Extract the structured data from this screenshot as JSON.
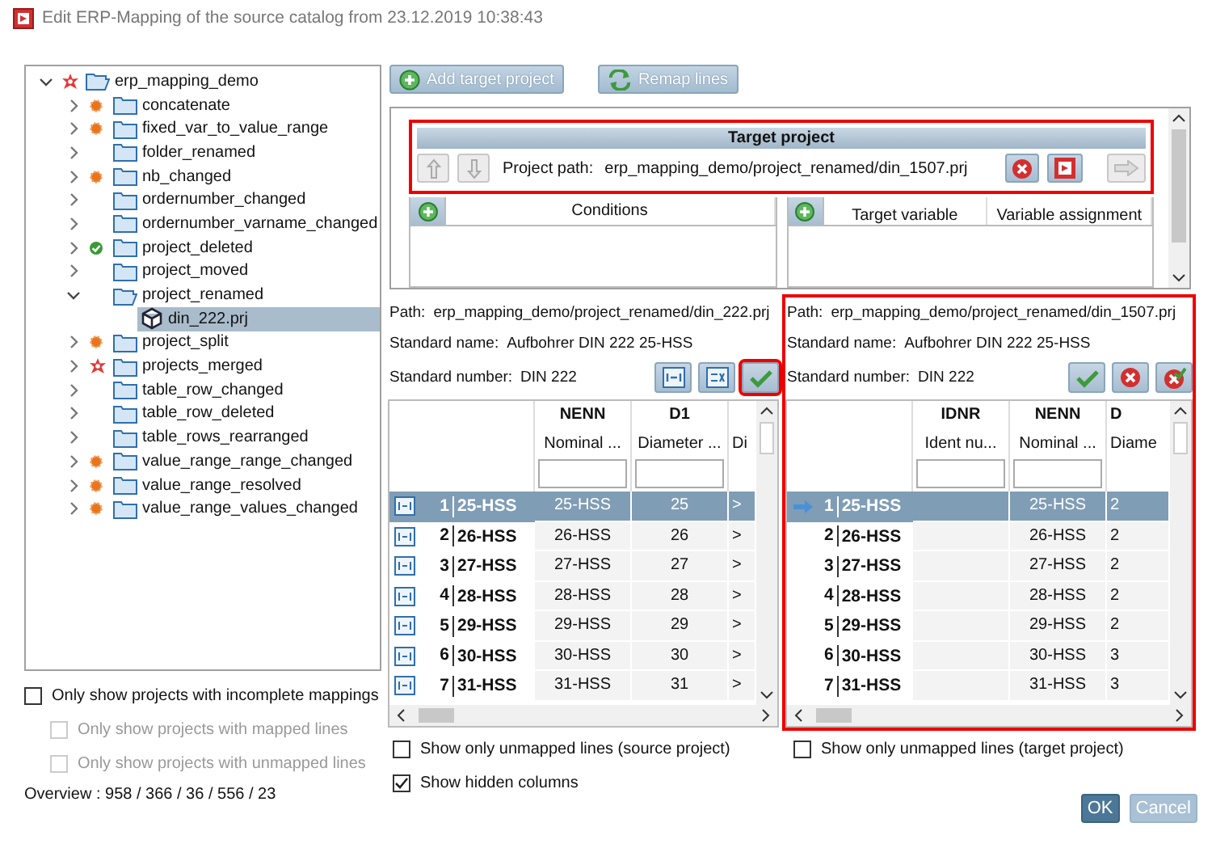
{
  "window": {
    "title": "Edit ERP-Mapping of the source catalog from 23.12.2019 10:38:43"
  },
  "tree": [
    {
      "label": "erp_mapping_demo",
      "kind": "folder",
      "badge": {
        "kind": "error"
      },
      "expanded": true,
      "selected": false,
      "children": [
        {
          "label": "concatenate",
          "kind": "folder",
          "badge": {
            "kind": "modified"
          },
          "expanded": false,
          "selected": false
        },
        {
          "label": "fixed_var_to_value_range",
          "kind": "folder",
          "badge": {
            "kind": "modified"
          },
          "expanded": false,
          "selected": false
        },
        {
          "label": "folder_renamed",
          "kind": "folder",
          "expanded": false,
          "selected": false
        },
        {
          "label": "nb_changed",
          "kind": "folder",
          "badge": {
            "kind": "modified"
          },
          "expanded": false,
          "selected": false
        },
        {
          "label": "ordernumber_changed",
          "kind": "folder",
          "expanded": false,
          "selected": false
        },
        {
          "label": "ordernumber_varname_changed",
          "kind": "folder",
          "expanded": false,
          "selected": false
        },
        {
          "label": "project_deleted",
          "kind": "folder",
          "badge": {
            "kind": "ok"
          },
          "expanded": false,
          "selected": false
        },
        {
          "label": "project_moved",
          "kind": "folder",
          "expanded": false,
          "selected": false
        },
        {
          "label": "project_renamed",
          "kind": "folder",
          "expanded": true,
          "selected": false,
          "children": [
            {
              "label": "din_222.prj",
              "kind": "file",
              "selected": true
            }
          ]
        },
        {
          "label": "project_split",
          "kind": "folder",
          "badge": {
            "kind": "modified"
          },
          "expanded": false,
          "selected": false
        },
        {
          "label": "projects_merged",
          "kind": "folder",
          "badge": {
            "kind": "error"
          },
          "expanded": false,
          "selected": false
        },
        {
          "label": "table_row_changed",
          "kind": "folder",
          "expanded": false,
          "selected": false
        },
        {
          "label": "table_row_deleted",
          "kind": "folder",
          "expanded": false,
          "selected": false
        },
        {
          "label": "table_rows_rearranged",
          "kind": "folder",
          "expanded": false,
          "selected": false
        },
        {
          "label": "value_range_range_changed",
          "kind": "folder",
          "badge": {
            "kind": "modified"
          },
          "expanded": false,
          "selected": false
        },
        {
          "label": "value_range_resolved",
          "kind": "folder",
          "badge": {
            "kind": "modified"
          },
          "expanded": false,
          "selected": false
        },
        {
          "label": "value_range_values_changed",
          "kind": "folder",
          "badge": {
            "kind": "modified"
          },
          "expanded": false,
          "selected": false
        }
      ]
    }
  ],
  "filters": [
    {
      "label": "Only show projects with incomplete mappings",
      "checked": false,
      "disabled": false,
      "children": [
        {
          "label": "Only show projects with mapped lines",
          "checked": false,
          "disabled": true
        },
        {
          "label": "Only show projects with unmapped lines",
          "checked": false,
          "disabled": true
        }
      ]
    }
  ],
  "overview": "Overview : 958 / 366 / 36 / 556 / 23",
  "toolbar": [
    {
      "label": "Add target project",
      "kind": "add"
    },
    {
      "label": "Remap lines",
      "kind": "remap"
    }
  ],
  "target_project": {
    "highlighted": true,
    "header": "Target project",
    "path_label": "Project path:",
    "path": "erp_mapping_demo/project_renamed/din_1507.prj",
    "buttons": [
      {
        "kind": "up",
        "disabled": true
      },
      {
        "kind": "down",
        "disabled": true
      },
      {
        "kind": "delete",
        "disabled": false
      },
      {
        "kind": "open",
        "disabled": false
      },
      {
        "kind": "next",
        "disabled": true
      }
    ]
  },
  "conditions": {
    "columns": [
      "Conditions"
    ]
  },
  "assignments": {
    "columns": [
      "Target variable",
      "Variable assignment"
    ]
  },
  "source": {
    "path_label": "Path:",
    "path": "erp_mapping_demo/project_renamed/din_222.prj",
    "name_label": "Standard name:",
    "name": "Aufbohrer DIN 222 25-HSS",
    "number_label": "Standard number:",
    "number": "DIN 222",
    "buttons": [
      {
        "kind": "view",
        "highlighted": false
      },
      {
        "kind": "edit",
        "highlighted": false
      },
      {
        "kind": "accept",
        "highlighted": true
      }
    ],
    "columns": [
      {
        "code": "NENN",
        "desc": "Nominal ..."
      },
      {
        "code": "D1",
        "desc": "Diameter ..."
      },
      {
        "desc": "Di"
      }
    ],
    "rows": [
      {
        "marker": {
          "kind": "mapped"
        },
        "index": "1",
        "key": "25-HSS",
        "cells": [
          "25-HSS",
          "25",
          ">"
        ],
        "selected": true
      },
      {
        "marker": {
          "kind": "mapped"
        },
        "index": "2",
        "key": "26-HSS",
        "cells": [
          "26-HSS",
          "26",
          ">"
        ],
        "selected": false
      },
      {
        "marker": {
          "kind": "mapped"
        },
        "index": "3",
        "key": "27-HSS",
        "cells": [
          "27-HSS",
          "27",
          ">"
        ],
        "selected": false
      },
      {
        "marker": {
          "kind": "mapped"
        },
        "index": "4",
        "key": "28-HSS",
        "cells": [
          "28-HSS",
          "28",
          ">"
        ],
        "selected": false
      },
      {
        "marker": {
          "kind": "mapped"
        },
        "index": "5",
        "key": "29-HSS",
        "cells": [
          "29-HSS",
          "29",
          ">"
        ],
        "selected": false
      },
      {
        "marker": {
          "kind": "mapped"
        },
        "index": "6",
        "key": "30-HSS",
        "cells": [
          "30-HSS",
          "30",
          ">"
        ],
        "selected": false
      },
      {
        "marker": {
          "kind": "mapped"
        },
        "index": "7",
        "key": "31-HSS",
        "cells": [
          "31-HSS",
          "31",
          ">"
        ],
        "selected": false
      }
    ]
  },
  "target": {
    "highlighted": true,
    "path_label": "Path:",
    "path": "erp_mapping_demo/project_renamed/din_1507.prj",
    "name_label": "Standard name:",
    "name": "Aufbohrer DIN 222 25-HSS",
    "number_label": "Standard number:",
    "number": "DIN 222",
    "buttons": [
      {
        "kind": "accept",
        "highlighted": false
      },
      {
        "kind": "delete",
        "highlighted": false
      },
      {
        "kind": "reset",
        "highlighted": false
      }
    ],
    "columns": [
      {
        "code": "IDNR",
        "desc": "Ident nu..."
      },
      {
        "code": "NENN",
        "desc": "Nominal ..."
      },
      {
        "code": "D",
        "desc": "Diame"
      }
    ],
    "rows": [
      {
        "marker": {
          "kind": "arrow"
        },
        "index": "1",
        "key": "25-HSS",
        "cells": [
          null,
          "25-HSS",
          "2"
        ],
        "selected": true
      },
      {
        "index": "2",
        "key": "26-HSS",
        "cells": [
          null,
          "26-HSS",
          "2"
        ],
        "selected": false
      },
      {
        "index": "3",
        "key": "27-HSS",
        "cells": [
          null,
          "27-HSS",
          "2"
        ],
        "selected": false
      },
      {
        "index": "4",
        "key": "28-HSS",
        "cells": [
          null,
          "28-HSS",
          "2"
        ],
        "selected": false
      },
      {
        "index": "5",
        "key": "29-HSS",
        "cells": [
          null,
          "29-HSS",
          "2"
        ],
        "selected": false
      },
      {
        "index": "6",
        "key": "30-HSS",
        "cells": [
          null,
          "30-HSS",
          "3"
        ],
        "selected": false
      },
      {
        "index": "7",
        "key": "31-HSS",
        "cells": [
          null,
          "31-HSS",
          "3"
        ],
        "selected": false
      }
    ]
  },
  "source_options": [
    {
      "label": "Show only unmapped lines (source project)",
      "checked": false
    },
    {
      "label": "Show hidden columns",
      "checked": true
    }
  ],
  "target_options": [
    {
      "label": "Show only unmapped lines (target project)",
      "checked": false
    }
  ],
  "footer": [
    {
      "label": "OK",
      "disabled": false
    },
    {
      "label": "Cancel",
      "disabled": true
    }
  ]
}
